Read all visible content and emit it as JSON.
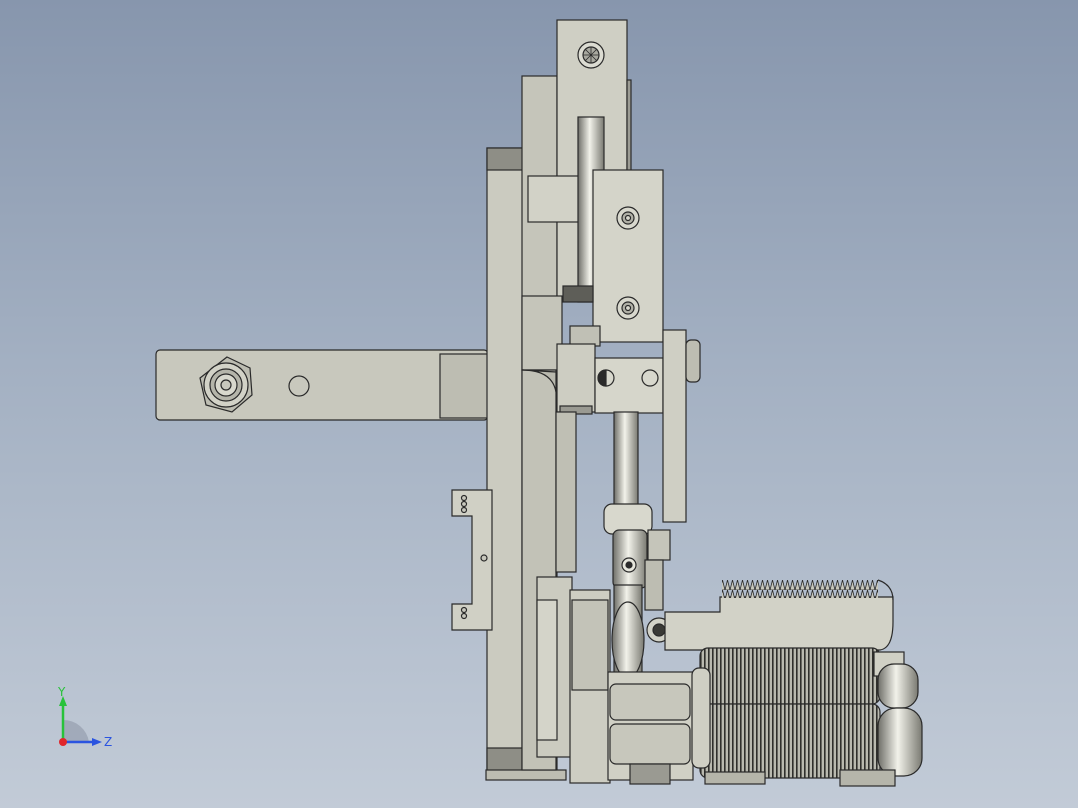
{
  "viewport": {
    "background_top": "#8796ad",
    "background_bottom": "#c2cbd7",
    "part_fill": "#c8c8bd",
    "part_edge": "#2a2a2a",
    "shadow_fill": "#8e8e86"
  },
  "triad": {
    "y_label": "Y",
    "z_label": "Z",
    "x_color": "#e0262b",
    "y_color": "#28c23a",
    "z_color": "#2b54e0"
  }
}
